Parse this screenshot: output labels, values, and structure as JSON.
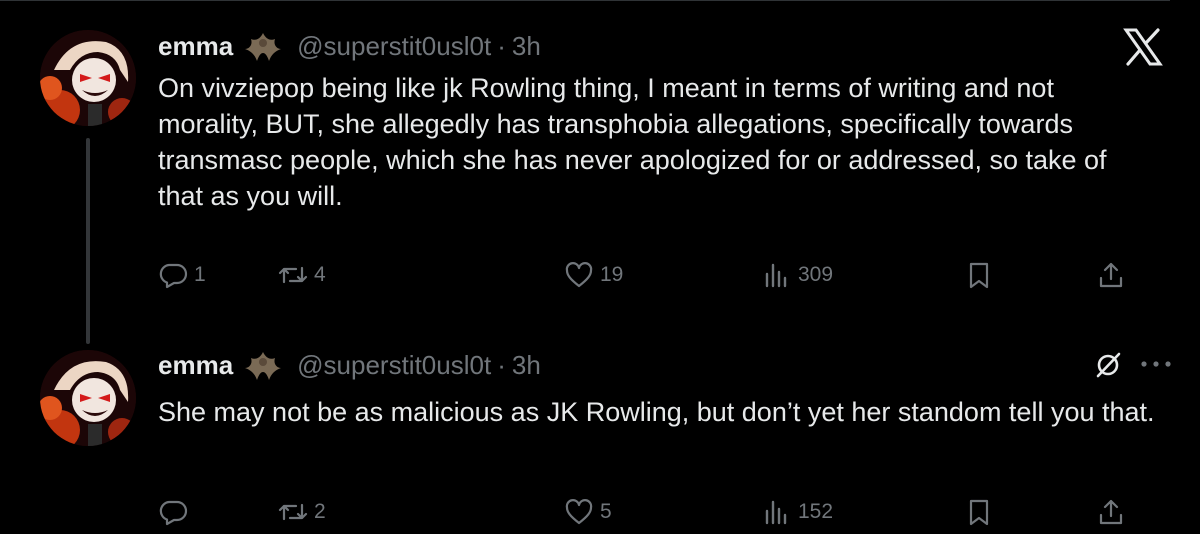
{
  "tweets": [
    {
      "author": {
        "name": "emma",
        "handle": "@superstit0usl0t",
        "badge_icon": "bat-emoji-icon"
      },
      "separator": "·",
      "time": "3h",
      "text": "On vivziepop being like jk Rowling thing, I meant in terms of writing and not morality, BUT, she allegedly has transphobia allegations, specifically towards transmasc people, which she has never apologized for or addressed, so take of that as you will.",
      "stats": {
        "replies": "1",
        "retweets": "4",
        "likes": "19",
        "views": "309"
      }
    },
    {
      "author": {
        "name": "emma",
        "handle": "@superstit0usl0t",
        "badge_icon": "bat-emoji-icon"
      },
      "separator": "·",
      "time": "3h",
      "text": "She may not be as malicious as JK Rowling, but don’t yet her standom tell you that.",
      "stats": {
        "replies": "",
        "retweets": "2",
        "likes": "5",
        "views": "152"
      }
    }
  ],
  "colors": {
    "background": "#000000",
    "text": "#e7e9ea",
    "muted": "#71767b",
    "divider": "#2f3336"
  }
}
